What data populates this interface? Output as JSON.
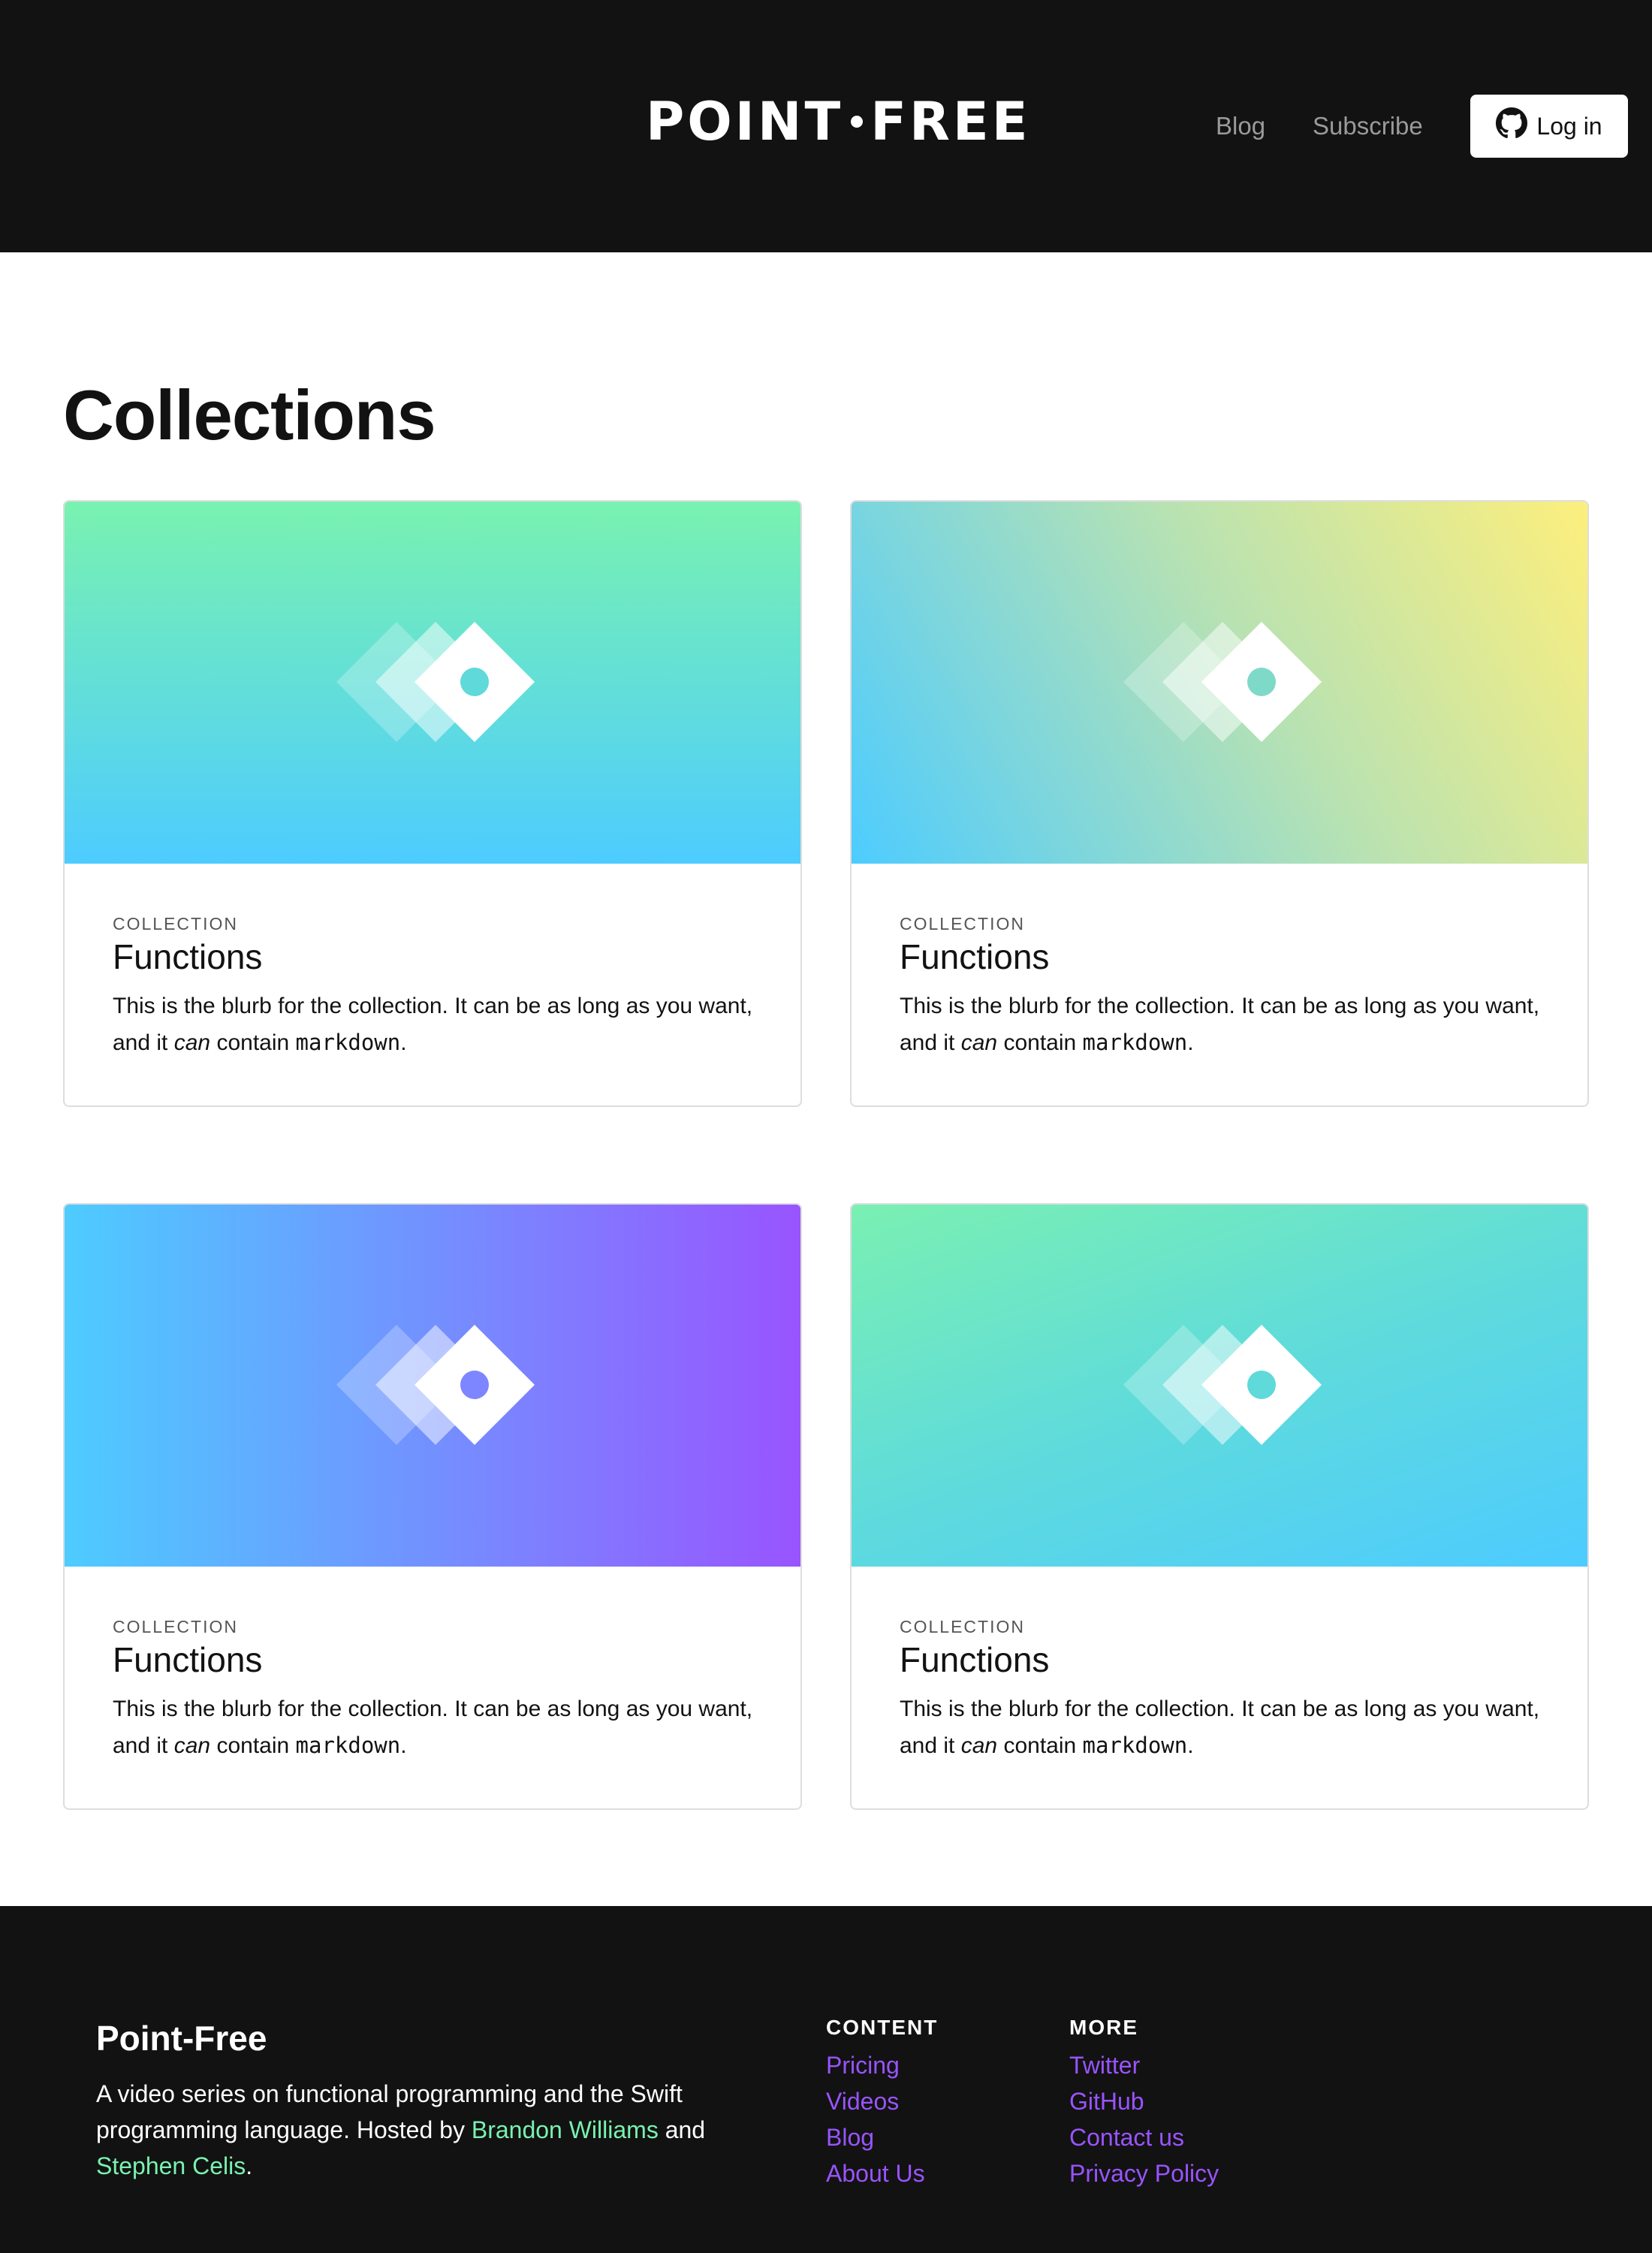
{
  "header": {
    "logo_left": "POINT",
    "logo_right": "FREE",
    "nav": {
      "blog": "Blog",
      "subscribe": "Subscribe"
    },
    "login_label": "Log in",
    "login_icon": "github-icon"
  },
  "main": {
    "title": "Collections",
    "cards": [
      {
        "eyebrow": "COLLECTION",
        "title": "Functions",
        "blurb_a": "This is the blurb for the collection. It can be as long as you want, and it ",
        "blurb_em": "can",
        "blurb_b": " contain ",
        "blurb_code": "markdown",
        "blurb_c": ".",
        "gradient": [
          "#79f2b0",
          "#4dccff"
        ],
        "dot_color": "#5fd9d9"
      },
      {
        "eyebrow": "COLLECTION",
        "title": "Functions",
        "blurb_a": "This is the blurb for the collection. It can be as long as you want, and it ",
        "blurb_em": "can",
        "blurb_b": " contain ",
        "blurb_code": "markdown",
        "blurb_c": ".",
        "gradient": [
          "#4dccff",
          "#fdef7d"
        ],
        "dot_color": "#7fd9c9"
      },
      {
        "eyebrow": "COLLECTION",
        "title": "Functions",
        "blurb_a": "This is the blurb for the collection. It can be as long as you want, and it ",
        "blurb_em": "can",
        "blurb_b": " contain ",
        "blurb_code": "markdown",
        "blurb_c": ".",
        "gradient": [
          "#4dccff",
          "#9954ff"
        ],
        "dot_color": "#7d86ff"
      },
      {
        "eyebrow": "COLLECTION",
        "title": "Functions",
        "blurb_a": "This is the blurb for the collection. It can be as long as you want, and it ",
        "blurb_em": "can",
        "blurb_b": " contain ",
        "blurb_code": "markdown",
        "blurb_c": ".",
        "gradient": [
          "#79f2b0",
          "#4dccff"
        ],
        "dot_color": "#5fd9d9"
      }
    ]
  },
  "footer": {
    "brand": "Point-Free",
    "about_a": "A video series on functional programming and the Swift programming language. Hosted by ",
    "host1": "Brandon Williams",
    "about_b": " and ",
    "host2": "Stephen Celis",
    "about_c": ".",
    "content_heading": "CONTENT",
    "content_links": [
      "Pricing",
      "Videos",
      "Blog",
      "About Us"
    ],
    "more_heading": "MORE",
    "more_links": [
      "Twitter",
      "GitHub",
      "Contact us",
      "Privacy Policy"
    ],
    "link_color": "#9954ff",
    "host_color": "#79f2b0"
  }
}
